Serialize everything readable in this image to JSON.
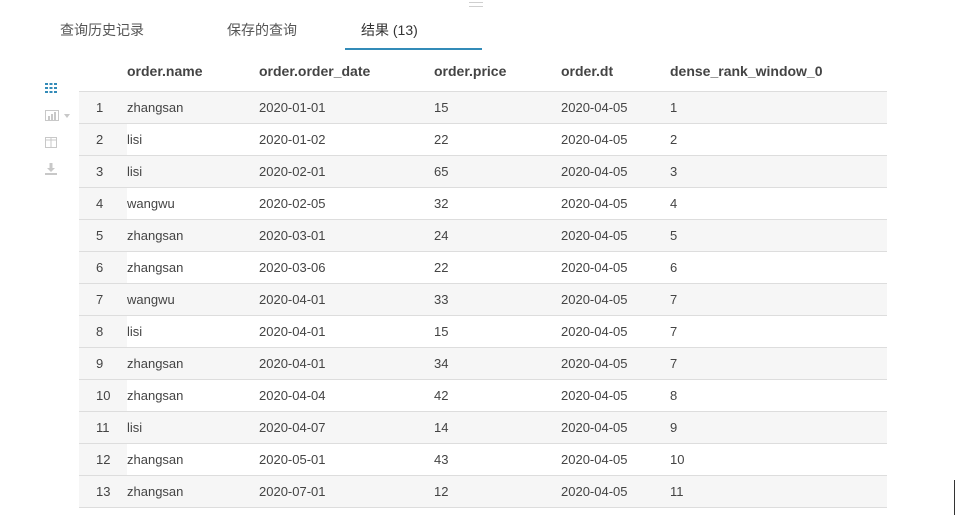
{
  "tabs": [
    {
      "label": "查询历史记录"
    },
    {
      "label": "保存的查询"
    },
    {
      "label": "结果 (13)"
    }
  ],
  "toolbar": {
    "grid_icon": "grid-icon",
    "chart_icon": "bar-chart-icon",
    "columns_icon": "columns-icon",
    "download_icon": "download-icon",
    "accent_color": "#338bb8"
  },
  "results": {
    "columns": [
      "order.name",
      "order.order_date",
      "order.price",
      "order.dt",
      "dense_rank_window_0"
    ],
    "rows": [
      [
        "1",
        "zhangsan",
        "2020-01-01",
        "15",
        "2020-04-05",
        "1"
      ],
      [
        "2",
        "lisi",
        "2020-01-02",
        "22",
        "2020-04-05",
        "2"
      ],
      [
        "3",
        "lisi",
        "2020-02-01",
        "65",
        "2020-04-05",
        "3"
      ],
      [
        "4",
        "wangwu",
        "2020-02-05",
        "32",
        "2020-04-05",
        "4"
      ],
      [
        "5",
        "zhangsan",
        "2020-03-01",
        "24",
        "2020-04-05",
        "5"
      ],
      [
        "6",
        "zhangsan",
        "2020-03-06",
        "22",
        "2020-04-05",
        "6"
      ],
      [
        "7",
        "wangwu",
        "2020-04-01",
        "33",
        "2020-04-05",
        "7"
      ],
      [
        "8",
        "lisi",
        "2020-04-01",
        "15",
        "2020-04-05",
        "7"
      ],
      [
        "9",
        "zhangsan",
        "2020-04-01",
        "34",
        "2020-04-05",
        "7"
      ],
      [
        "10",
        "zhangsan",
        "2020-04-04",
        "42",
        "2020-04-05",
        "8"
      ],
      [
        "11",
        "lisi",
        "2020-04-07",
        "14",
        "2020-04-05",
        "9"
      ],
      [
        "12",
        "zhangsan",
        "2020-05-01",
        "43",
        "2020-04-05",
        "10"
      ],
      [
        "13",
        "zhangsan",
        "2020-07-01",
        "12",
        "2020-04-05",
        "11"
      ]
    ]
  }
}
